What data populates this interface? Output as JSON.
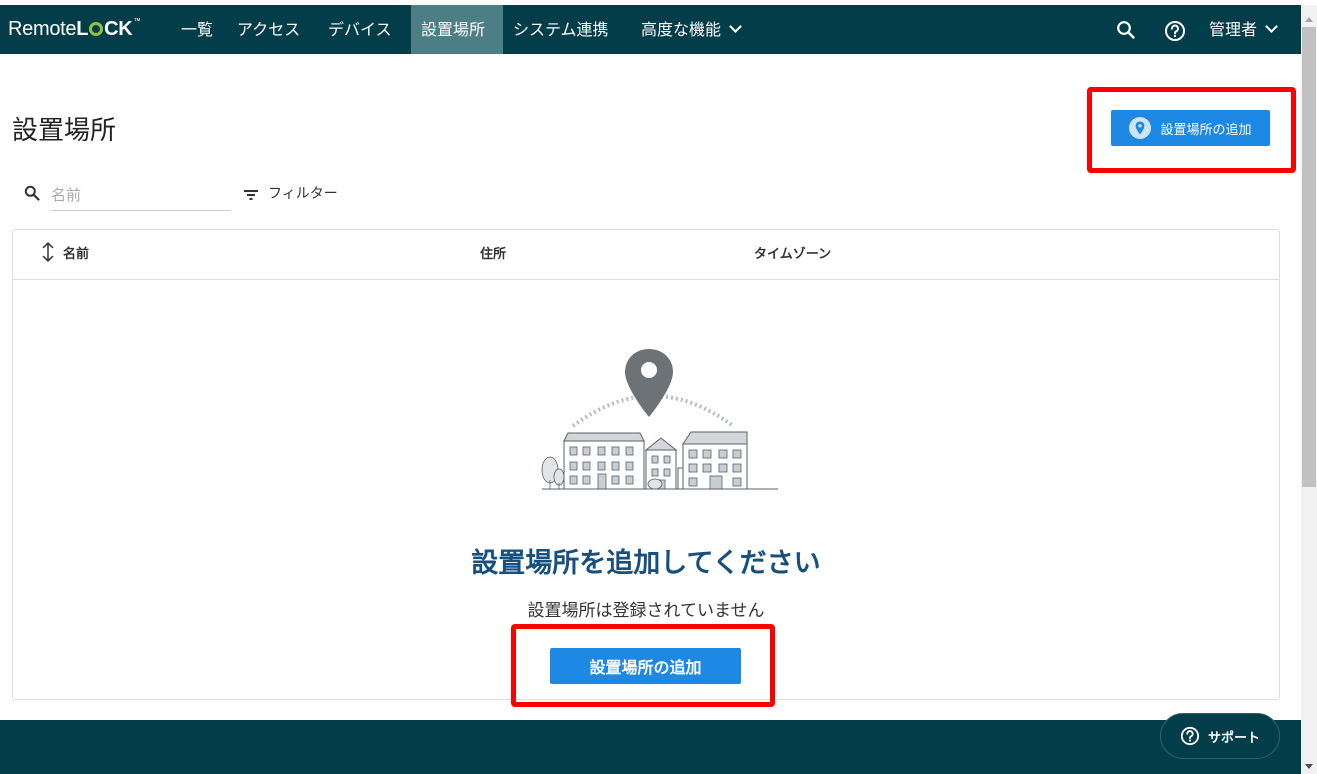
{
  "app": {
    "logo_text_light": "Remote",
    "logo_text_bold_1": "L",
    "logo_text_bold_2": "CK",
    "logo_tm": "™"
  },
  "nav": {
    "items": [
      {
        "label": "一覧"
      },
      {
        "label": "アクセス"
      },
      {
        "label": "デバイス"
      },
      {
        "label": "設置場所",
        "active": true
      },
      {
        "label": "システム連携"
      },
      {
        "label": "高度な機能"
      }
    ],
    "user_label": "管理者",
    "icons": [
      "search-icon",
      "help-icon",
      "chevron-down-icon"
    ]
  },
  "page": {
    "title": "設置場所",
    "add_button_label": "設置場所の追加"
  },
  "search": {
    "placeholder": "名前",
    "value": ""
  },
  "filter": {
    "label": "フィルター"
  },
  "table": {
    "columns": [
      "名前",
      "住所",
      "タイムゾーン"
    ],
    "rows": []
  },
  "empty_state": {
    "title": "設置場所を追加してください",
    "subtitle": "設置場所は登録されていません",
    "button_label": "設置場所の追加"
  },
  "support": {
    "label": "サポート"
  },
  "colors": {
    "nav_bg": "#033d4a",
    "nav_active": "#4d7d85",
    "primary": "#1e88e5",
    "empty_title": "#17507d",
    "highlight": "#ff0000"
  }
}
